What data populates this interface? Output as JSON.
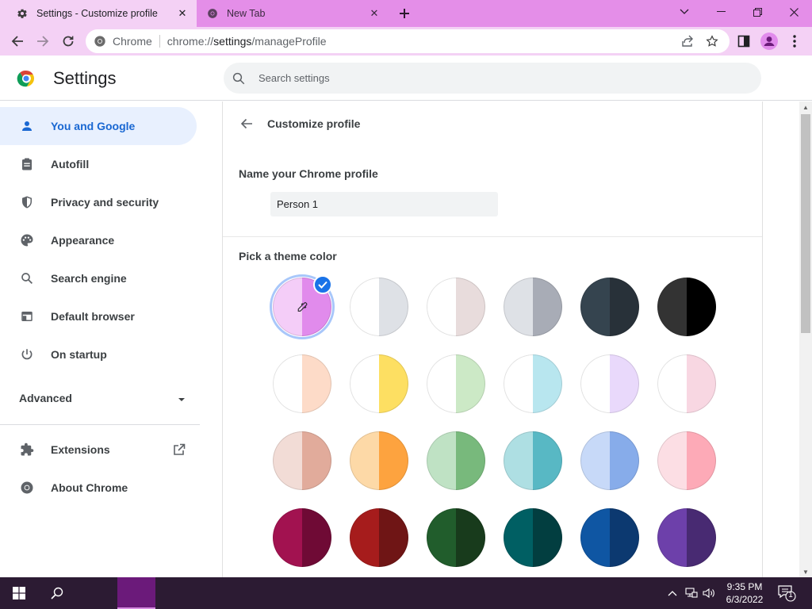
{
  "tabs": [
    {
      "title": "Settings - Customize profile",
      "icon": "gear-icon",
      "active": true
    },
    {
      "title": "New Tab",
      "icon": "chrome-icon",
      "active": false
    }
  ],
  "omnibox": {
    "site_label": "Chrome",
    "url_scheme": "chrome://",
    "url_host": "settings",
    "url_path": "/manageProfile"
  },
  "header": {
    "title": "Settings",
    "search_placeholder": "Search settings"
  },
  "sidebar": {
    "items": [
      {
        "label": "You and Google",
        "icon": "person-icon",
        "active": true
      },
      {
        "label": "Autofill",
        "icon": "clipboard-icon",
        "active": false
      },
      {
        "label": "Privacy and security",
        "icon": "shield-icon",
        "active": false
      },
      {
        "label": "Appearance",
        "icon": "palette-icon",
        "active": false
      },
      {
        "label": "Search engine",
        "icon": "search-icon",
        "active": false
      },
      {
        "label": "Default browser",
        "icon": "browser-window-icon",
        "active": false
      },
      {
        "label": "On startup",
        "icon": "power-icon",
        "active": false
      }
    ],
    "advanced_label": "Advanced",
    "extensions_label": "Extensions",
    "about_label": "About Chrome"
  },
  "main": {
    "subpage_title": "Customize profile",
    "name_label": "Name your Chrome profile",
    "name_value": "Person 1",
    "theme_label": "Pick a theme color",
    "selected_theme_index": 0,
    "themes": [
      {
        "left": "#f4cdf8",
        "right": "#e18bec",
        "name": "custom"
      },
      {
        "left": "#ffffff",
        "right": "#dee1e6"
      },
      {
        "left": "#ffffff",
        "right": "#e8dcdc"
      },
      {
        "left": "#dee1e6",
        "right": "#a8acb6"
      },
      {
        "left": "#35444f",
        "right": "#283139"
      },
      {
        "left": "#333333",
        "right": "#000000"
      },
      {
        "left": "#ffffff",
        "right": "#fddbc8"
      },
      {
        "left": "#ffffff",
        "right": "#fddf62"
      },
      {
        "left": "#ffffff",
        "right": "#cce9c6"
      },
      {
        "left": "#ffffff",
        "right": "#b8e6ef"
      },
      {
        "left": "#ffffff",
        "right": "#e9d9fb"
      },
      {
        "left": "#ffffff",
        "right": "#f8d7e2"
      },
      {
        "left": "#f2dcd6",
        "right": "#e1ab9b"
      },
      {
        "left": "#fdd9a7",
        "right": "#fda33f"
      },
      {
        "left": "#bfe2c4",
        "right": "#78b97c"
      },
      {
        "left": "#aedfe3",
        "right": "#58b8c4"
      },
      {
        "left": "#c7d9f8",
        "right": "#87acea"
      },
      {
        "left": "#fcdee4",
        "right": "#fdaab7"
      },
      {
        "left": "#a21250",
        "right": "#6f0a35"
      },
      {
        "left": "#a61c1c",
        "right": "#6f1515"
      },
      {
        "left": "#215d2c",
        "right": "#183b1c"
      },
      {
        "left": "#005f63",
        "right": "#023e40"
      },
      {
        "left": "#0f56a3",
        "right": "#0c3970"
      },
      {
        "left": "#6d40aa",
        "right": "#482a72"
      }
    ]
  },
  "taskbar": {
    "time": "9:35 PM",
    "date": "6/3/2022",
    "notification_count": "1"
  },
  "colors": {
    "tabstrip": "#e48ee8",
    "toolbar": "#f4d1f5",
    "accent": "#1a73e8",
    "taskbar": "#2c1b33"
  }
}
